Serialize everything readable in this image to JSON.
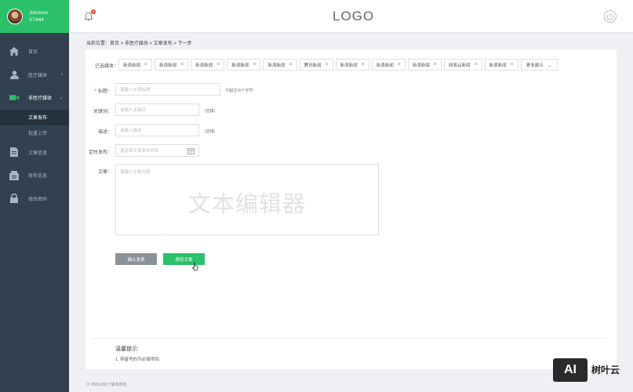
{
  "user": {
    "name": "Johnson",
    "id": "V7444"
  },
  "header": {
    "logo": "LOGO",
    "notification_count": "3"
  },
  "sidebar": {
    "items": [
      {
        "label": "首页",
        "icon": "home-icon"
      },
      {
        "label": "医疗媒体",
        "icon": "user-icon"
      },
      {
        "label": "非医疗媒体",
        "icon": "video-icon"
      },
      {
        "label": "文章信息",
        "icon": "document-icon"
      },
      {
        "label": "财务信息",
        "icon": "finance-icon"
      },
      {
        "label": "修改密码",
        "icon": "lock-icon"
      }
    ],
    "sub_items": [
      {
        "label": "文章发布"
      },
      {
        "label": "批量上传"
      }
    ]
  },
  "breadcrumb": "当前位置：首页 > 非医疗媒体 > 文章发布 > 下一步",
  "form": {
    "media_label": "已选媒体：",
    "media_tags": [
      "新浪新闻",
      "新浪新闻",
      "新浪新闻",
      "新浪新闻",
      "新浪新闻",
      "腾讯新闻",
      "新浪新闻",
      "新浪新闻",
      "新浪新闻",
      "网易云新闻",
      "新浪新闻"
    ],
    "more_label": "更多展示",
    "title_label": "标题：",
    "title_placeholder": "请输入文章标题",
    "title_hint": "不超过20个字符",
    "keywords_label": "关键词：",
    "keywords_placeholder": "请输入关键词",
    "keywords_hint": "(选填)",
    "desc_label": "描述：",
    "desc_placeholder": "请输入描述",
    "desc_hint": "(选填)",
    "schedule_label": "定时发布：",
    "schedule_placeholder": "请选择文章发布时间",
    "article_label": "文章：",
    "article_placeholder": "请输入文章内容",
    "editor_watermark": "文本编辑器",
    "confirm_button": "确认发表",
    "preview_button": "预览文章"
  },
  "tips": {
    "title": "温馨提示:",
    "line1": "1. 带星号的为必填项目;"
  },
  "footer": "© 2003-2017 版本所有",
  "watermark": {
    "box_text": "AI",
    "brand": "树叶云"
  },
  "colors": {
    "accent": "#2bc06a",
    "sidebar": "#324150",
    "required": "#e74c3c"
  }
}
